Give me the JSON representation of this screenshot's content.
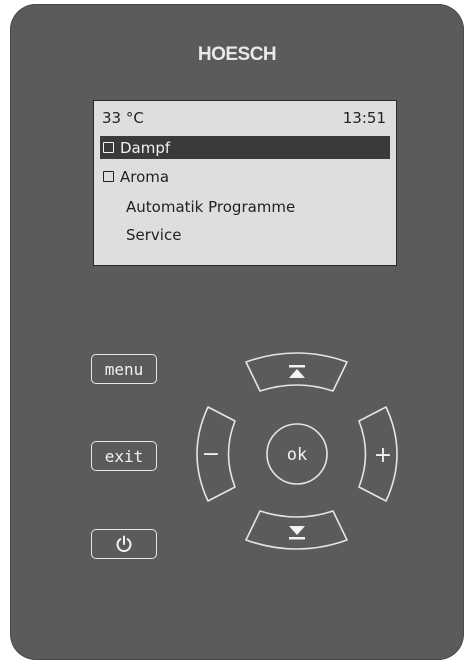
{
  "brand": {
    "name": "HOESCH"
  },
  "display": {
    "temperature": "33 °C",
    "time": "13:51",
    "menu": [
      {
        "label": "Dampf",
        "has_checkbox": true,
        "checked": false,
        "selected": true
      },
      {
        "label": "Aroma",
        "has_checkbox": true,
        "checked": false,
        "selected": false
      },
      {
        "label": "Automatik Programme",
        "has_checkbox": false,
        "selected": false
      },
      {
        "label": "Service",
        "has_checkbox": false,
        "selected": false
      }
    ]
  },
  "keys": {
    "menu_label": "menu",
    "exit_label": "exit",
    "power_icon": "power-icon"
  },
  "nav": {
    "ok_label": "ok",
    "minus_label": "−",
    "plus_label": "+",
    "up_icon": "arrow-up-to-bar-icon",
    "down_icon": "arrow-down-to-bar-icon"
  },
  "colors": {
    "panel": "#5b5b5b",
    "screen": "#dedede",
    "selection": "#3a3a3a",
    "button_stroke": "#e5e5e5"
  }
}
